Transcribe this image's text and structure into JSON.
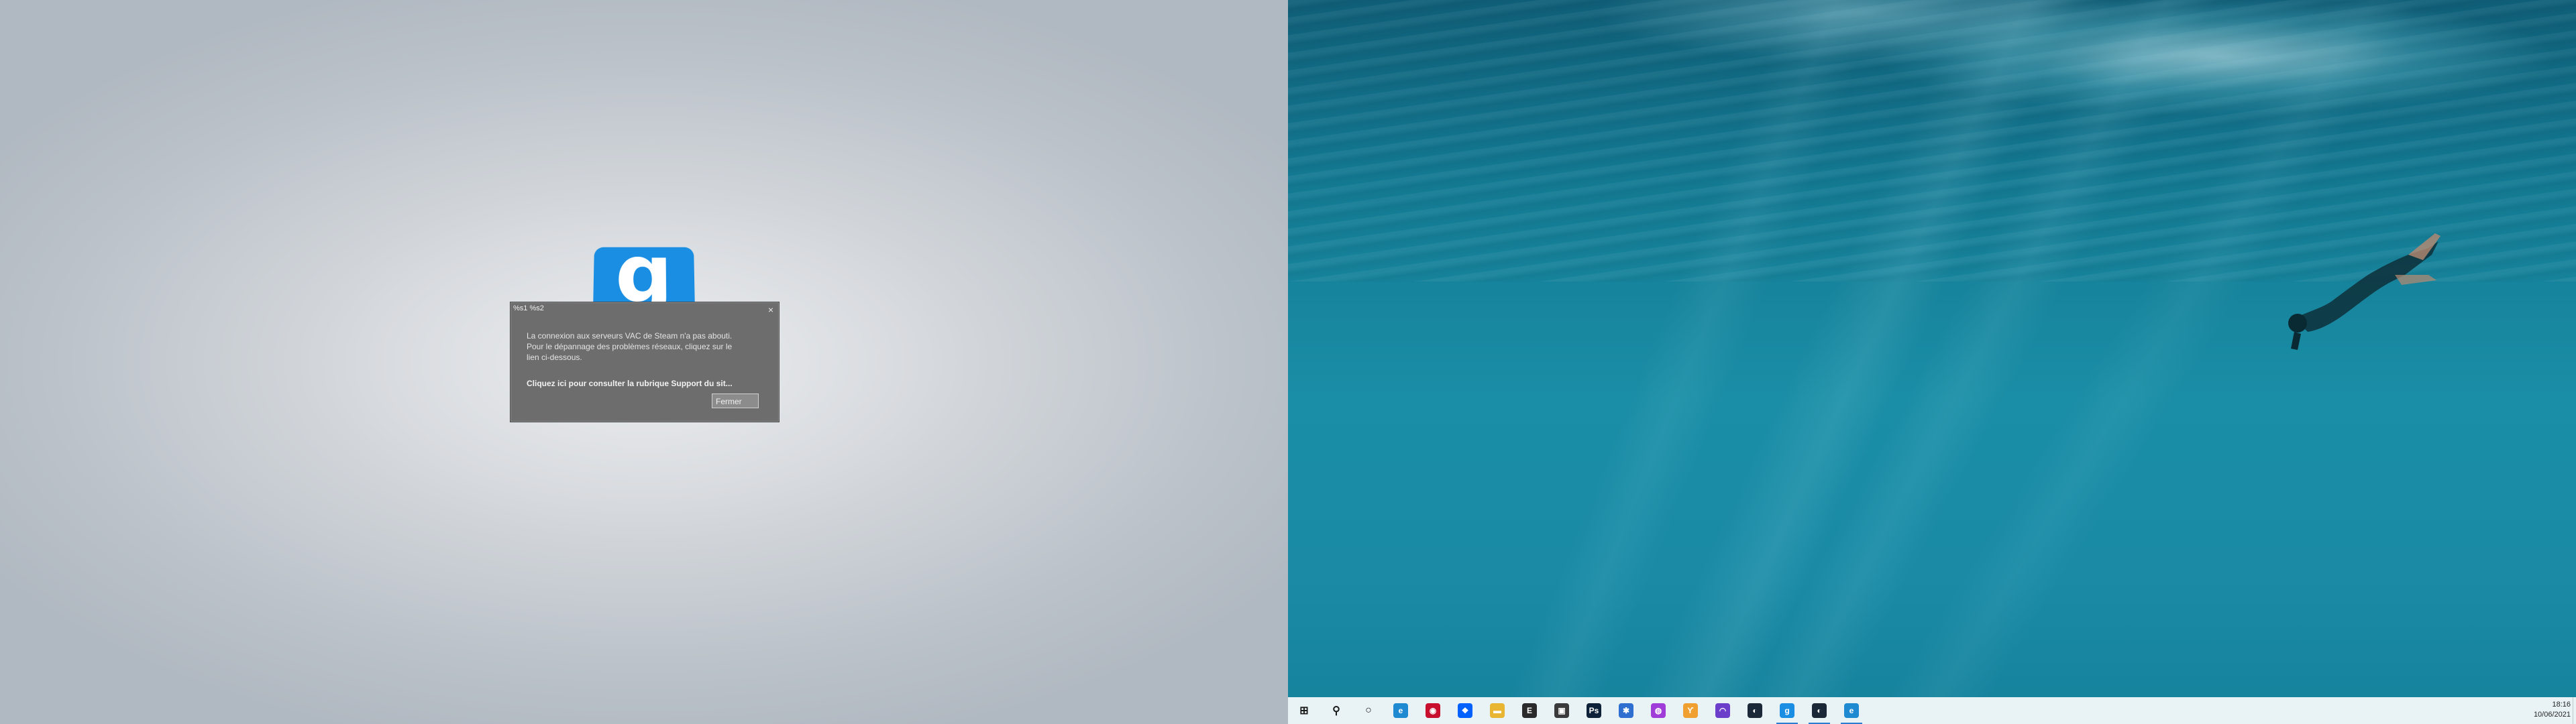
{
  "desktop": {
    "left_background": "#d7dade",
    "right_background": "#137a93"
  },
  "game": {
    "logo_letter": "g",
    "logo_color": "#1a8ee3"
  },
  "dialog": {
    "title": "%s1 %s2",
    "close_glyph": "×",
    "message_line1": "La connexion aux serveurs VAC de Steam n'a pas abouti.",
    "message_line2": "Pour le dépannage des problèmes réseaux, cliquez sur le",
    "message_line3": "lien ci-dessous.",
    "link_text": "Cliquez ici pour consulter la rubrique Support du sit...",
    "close_button": "Fermer",
    "background": "#6d6d6d"
  },
  "taskbar": {
    "items": [
      {
        "name": "start",
        "icon": "windows-icon",
        "glyph": "⊞",
        "color": "#1a1a1a"
      },
      {
        "name": "search",
        "icon": "search-icon",
        "glyph": "⚲",
        "color": "#1a1a1a"
      },
      {
        "name": "cortana",
        "icon": "cortana-icon",
        "glyph": "○",
        "color": "#1a1a1a"
      },
      {
        "name": "edge",
        "icon": "edge-icon",
        "glyph": "e",
        "color": "#1f8ad2"
      },
      {
        "name": "app-red",
        "icon": "app-red-icon",
        "glyph": "◉",
        "color": "#c8102e"
      },
      {
        "name": "dropbox",
        "icon": "dropbox-icon",
        "glyph": "❖",
        "color": "#0061fe"
      },
      {
        "name": "explorer",
        "icon": "folder-icon",
        "glyph": "▬",
        "color": "#e8b632"
      },
      {
        "name": "epic",
        "icon": "epic-games-icon",
        "glyph": "E",
        "color": "#2a2a2a"
      },
      {
        "name": "store",
        "icon": "store-icon",
        "glyph": "▣",
        "color": "#3a3a3a"
      },
      {
        "name": "photoshop",
        "icon": "photoshop-icon",
        "glyph": "Ps",
        "color": "#0d2238"
      },
      {
        "name": "app-blue",
        "icon": "app-blue-icon",
        "glyph": "✱",
        "color": "#2e6fcf"
      },
      {
        "name": "messenger",
        "icon": "messenger-icon",
        "glyph": "◍",
        "color": "#a03cd8"
      },
      {
        "name": "app-orange",
        "icon": "app-orange-icon",
        "glyph": "ϒ",
        "color": "#f0a030"
      },
      {
        "name": "headset",
        "icon": "headset-icon",
        "glyph": "◠",
        "color": "#6b3fc9"
      },
      {
        "name": "steam",
        "icon": "steam-icon",
        "glyph": "◐",
        "color": "#1b2838"
      },
      {
        "name": "gmod",
        "icon": "gmod-icon",
        "glyph": "g",
        "color": "#1a8ee3",
        "active": true
      },
      {
        "name": "steam-2",
        "icon": "steam-icon",
        "glyph": "◐",
        "color": "#1b2838",
        "active": true
      },
      {
        "name": "edge-2",
        "icon": "edge-icon",
        "glyph": "e",
        "color": "#1f8ad2",
        "active": true
      }
    ],
    "time": "18:16",
    "date": "10/06/2021"
  }
}
